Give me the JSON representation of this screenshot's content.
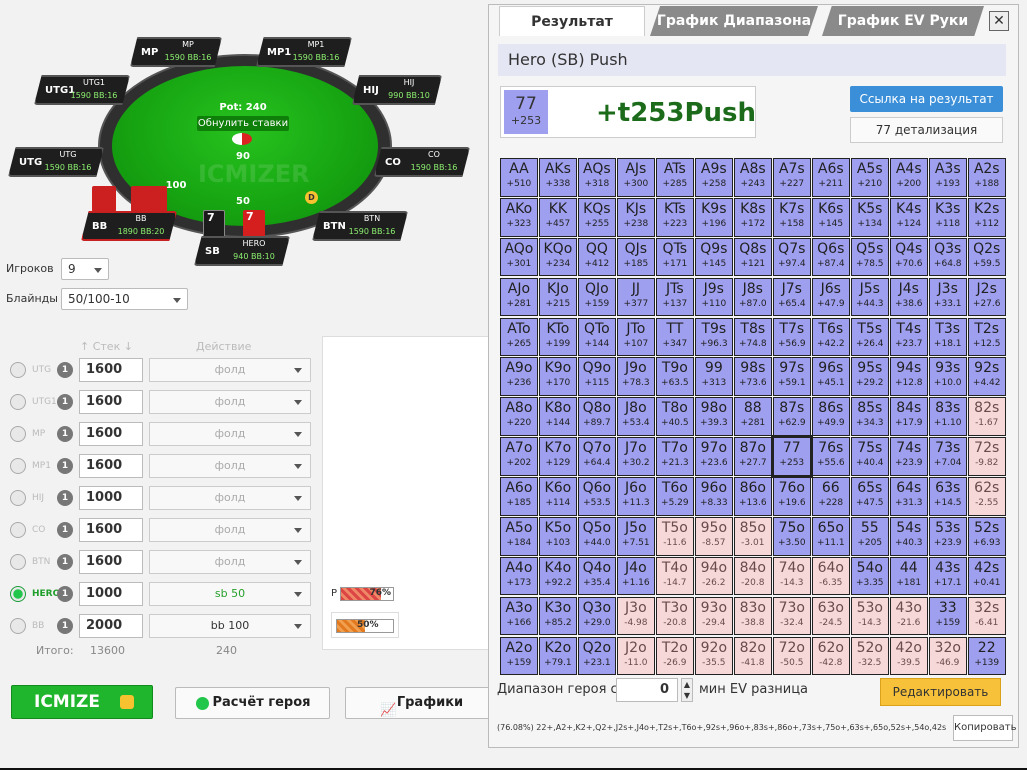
{
  "table": {
    "seats": [
      {
        "pos": "MP",
        "name": "MP",
        "stack": "1590",
        "bb": "BB:16"
      },
      {
        "pos": "MP1",
        "name": "MP1",
        "stack": "1590",
        "bb": "BB:16"
      },
      {
        "pos": "UTG1",
        "name": "UTG1",
        "stack": "1590",
        "bb": "BB:16"
      },
      {
        "pos": "HIJ",
        "name": "HIJ",
        "stack": "990",
        "bb": "BB:10"
      },
      {
        "pos": "UTG",
        "name": "UTG",
        "stack": "1590",
        "bb": "BB:16"
      },
      {
        "pos": "CO",
        "name": "CO",
        "stack": "1590",
        "bb": "BB:16"
      },
      {
        "pos": "BB",
        "name": "BB",
        "stack": "1890",
        "bb": "BB:20"
      },
      {
        "pos": "BTN",
        "name": "BTN",
        "stack": "1590",
        "bb": "BB:16"
      },
      {
        "pos": "SB",
        "name": "HERO",
        "stack": "940",
        "bb": "BB:10"
      }
    ],
    "pot": "Pot: 240",
    "reset": "Обнулить ставки",
    "center_bet": "90",
    "bet_left": "100",
    "bet_sb": "50",
    "watermark": "ICMIZER",
    "hero_cards": [
      "7",
      "7"
    ],
    "dealer": "D"
  },
  "settings": {
    "players_label": "Игроков",
    "players_value": "9",
    "blinds_label": "Блайнды",
    "blinds_value": "50/100-10"
  },
  "players_table": {
    "stack_header": "Стек",
    "action_header": "Действие",
    "rows": [
      {
        "pos": "UTG",
        "n": "1",
        "stack": "1600",
        "action": "фолд"
      },
      {
        "pos": "UTG1",
        "n": "1",
        "stack": "1600",
        "action": "фолд"
      },
      {
        "pos": "MP",
        "n": "1",
        "stack": "1600",
        "action": "фолд"
      },
      {
        "pos": "MP1",
        "n": "1",
        "stack": "1600",
        "action": "фолд"
      },
      {
        "pos": "HIJ",
        "n": "1",
        "stack": "1000",
        "action": "фолд"
      },
      {
        "pos": "CO",
        "n": "1",
        "stack": "1600",
        "action": "фолд"
      },
      {
        "pos": "BTN",
        "n": "1",
        "stack": "1600",
        "action": "фолд"
      },
      {
        "pos": "HERO",
        "n": "1",
        "stack": "1000",
        "action": "sb 50"
      },
      {
        "pos": "BB",
        "n": "1",
        "stack": "2000",
        "action": "bb 100"
      }
    ],
    "total_label": "Итого:",
    "total_stack": "13600",
    "total_action": "240"
  },
  "range_bars": {
    "p_label": "P",
    "p_value": "76%",
    "p_fraction": 0.76,
    "h_value": "50%",
    "h_fraction": 0.5
  },
  "bottom": {
    "icmize": "ICMIZE",
    "hero_calc": "Расчёт героя",
    "charts": "Графики"
  },
  "panel": {
    "tabs": [
      "Результат",
      "График Диапазона",
      "График EV Руки"
    ],
    "header": "Hero (SB) Push",
    "hand": "77",
    "hand_ev": "+253",
    "result": "+t253Push",
    "link_btn": "Ссылка на результат",
    "detail_btn": "77 детализация",
    "range_label": "Диапазон героя с",
    "range_value": "0",
    "range_suffix": "мин EV разница",
    "edit_btn": "Редактировать",
    "range_text": "(76.08%) 22+,A2+,K2+,Q2+,J2s+,J4o+,T2s+,T6o+,92s+,96o+,83s+,86o+,73s+,75o+,63s+,65o,52s+,54o,42s+",
    "copy_btn": "Копировать"
  },
  "matrix": [
    [
      [
        "AA",
        "+510"
      ],
      [
        "AKs",
        "+338"
      ],
      [
        "AQs",
        "+318"
      ],
      [
        "AJs",
        "+300"
      ],
      [
        "ATs",
        "+285"
      ],
      [
        "A9s",
        "+258"
      ],
      [
        "A8s",
        "+243"
      ],
      [
        "A7s",
        "+227"
      ],
      [
        "A6s",
        "+211"
      ],
      [
        "A5s",
        "+210"
      ],
      [
        "A4s",
        "+200"
      ],
      [
        "A3s",
        "+193"
      ],
      [
        "A2s",
        "+188"
      ]
    ],
    [
      [
        "AKo",
        "+323"
      ],
      [
        "KK",
        "+457"
      ],
      [
        "KQs",
        "+255"
      ],
      [
        "KJs",
        "+238"
      ],
      [
        "KTs",
        "+223"
      ],
      [
        "K9s",
        "+196"
      ],
      [
        "K8s",
        "+172"
      ],
      [
        "K7s",
        "+158"
      ],
      [
        "K6s",
        "+145"
      ],
      [
        "K5s",
        "+134"
      ],
      [
        "K4s",
        "+124"
      ],
      [
        "K3s",
        "+118"
      ],
      [
        "K2s",
        "+112"
      ]
    ],
    [
      [
        "AQo",
        "+301"
      ],
      [
        "KQo",
        "+234"
      ],
      [
        "QQ",
        "+412"
      ],
      [
        "QJs",
        "+185"
      ],
      [
        "QTs",
        "+171"
      ],
      [
        "Q9s",
        "+145"
      ],
      [
        "Q8s",
        "+121"
      ],
      [
        "Q7s",
        "+97.4"
      ],
      [
        "Q6s",
        "+87.4"
      ],
      [
        "Q5s",
        "+78.5"
      ],
      [
        "Q4s",
        "+70.6"
      ],
      [
        "Q3s",
        "+64.8"
      ],
      [
        "Q2s",
        "+59.5"
      ]
    ],
    [
      [
        "AJo",
        "+281"
      ],
      [
        "KJo",
        "+215"
      ],
      [
        "QJo",
        "+159"
      ],
      [
        "JJ",
        "+377"
      ],
      [
        "JTs",
        "+137"
      ],
      [
        "J9s",
        "+110"
      ],
      [
        "J8s",
        "+87.0"
      ],
      [
        "J7s",
        "+65.4"
      ],
      [
        "J6s",
        "+47.9"
      ],
      [
        "J5s",
        "+44.3"
      ],
      [
        "J4s",
        "+38.6"
      ],
      [
        "J3s",
        "+33.1"
      ],
      [
        "J2s",
        "+27.6"
      ]
    ],
    [
      [
        "ATo",
        "+265"
      ],
      [
        "KTo",
        "+199"
      ],
      [
        "QTo",
        "+144"
      ],
      [
        "JTo",
        "+107"
      ],
      [
        "TT",
        "+347"
      ],
      [
        "T9s",
        "+96.3"
      ],
      [
        "T8s",
        "+74.8"
      ],
      [
        "T7s",
        "+56.9"
      ],
      [
        "T6s",
        "+42.2"
      ],
      [
        "T5s",
        "+26.4"
      ],
      [
        "T4s",
        "+23.7"
      ],
      [
        "T3s",
        "+18.1"
      ],
      [
        "T2s",
        "+12.5"
      ]
    ],
    [
      [
        "A9o",
        "+236"
      ],
      [
        "K9o",
        "+170"
      ],
      [
        "Q9o",
        "+115"
      ],
      [
        "J9o",
        "+78.3"
      ],
      [
        "T9o",
        "+63.5"
      ],
      [
        "99",
        "+313"
      ],
      [
        "98s",
        "+73.6"
      ],
      [
        "97s",
        "+59.1"
      ],
      [
        "96s",
        "+45.1"
      ],
      [
        "95s",
        "+29.2"
      ],
      [
        "94s",
        "+12.8"
      ],
      [
        "93s",
        "+10.0"
      ],
      [
        "92s",
        "+4.42"
      ]
    ],
    [
      [
        "A8o",
        "+220"
      ],
      [
        "K8o",
        "+144"
      ],
      [
        "Q8o",
        "+89.7"
      ],
      [
        "J8o",
        "+53.4"
      ],
      [
        "T8o",
        "+40.5"
      ],
      [
        "98o",
        "+39.3"
      ],
      [
        "88",
        "+281"
      ],
      [
        "87s",
        "+62.9"
      ],
      [
        "86s",
        "+49.9"
      ],
      [
        "85s",
        "+34.3"
      ],
      [
        "84s",
        "+17.9"
      ],
      [
        "83s",
        "+1.10"
      ],
      [
        "82s",
        "-1.67"
      ]
    ],
    [
      [
        "A7o",
        "+202"
      ],
      [
        "K7o",
        "+129"
      ],
      [
        "Q7o",
        "+64.4"
      ],
      [
        "J7o",
        "+30.2"
      ],
      [
        "T7o",
        "+21.3"
      ],
      [
        "97o",
        "+23.6"
      ],
      [
        "87o",
        "+27.7"
      ],
      [
        "77",
        "+253"
      ],
      [
        "76s",
        "+55.6"
      ],
      [
        "75s",
        "+40.4"
      ],
      [
        "74s",
        "+23.9"
      ],
      [
        "73s",
        "+7.04"
      ],
      [
        "72s",
        "-9.82"
      ]
    ],
    [
      [
        "A6o",
        "+185"
      ],
      [
        "K6o",
        "+114"
      ],
      [
        "Q6o",
        "+53.5"
      ],
      [
        "J6o",
        "+11.3"
      ],
      [
        "T6o",
        "+5.29"
      ],
      [
        "96o",
        "+8.33"
      ],
      [
        "86o",
        "+13.6"
      ],
      [
        "76o",
        "+19.6"
      ],
      [
        "66",
        "+228"
      ],
      [
        "65s",
        "+47.5"
      ],
      [
        "64s",
        "+31.3"
      ],
      [
        "63s",
        "+14.5"
      ],
      [
        "62s",
        "-2.55"
      ]
    ],
    [
      [
        "A5o",
        "+184"
      ],
      [
        "K5o",
        "+103"
      ],
      [
        "Q5o",
        "+44.0"
      ],
      [
        "J5o",
        "+7.51"
      ],
      [
        "T5o",
        "-11.6"
      ],
      [
        "95o",
        "-8.57"
      ],
      [
        "85o",
        "-3.01"
      ],
      [
        "75o",
        "+3.50"
      ],
      [
        "65o",
        "+11.1"
      ],
      [
        "55",
        "+205"
      ],
      [
        "54s",
        "+40.3"
      ],
      [
        "53s",
        "+23.9"
      ],
      [
        "52s",
        "+6.93"
      ]
    ],
    [
      [
        "A4o",
        "+173"
      ],
      [
        "K4o",
        "+92.2"
      ],
      [
        "Q4o",
        "+35.4"
      ],
      [
        "J4o",
        "+1.16"
      ],
      [
        "T4o",
        "-14.7"
      ],
      [
        "94o",
        "-26.2"
      ],
      [
        "84o",
        "-20.8"
      ],
      [
        "74o",
        "-14.3"
      ],
      [
        "64o",
        "-6.35"
      ],
      [
        "54o",
        "+3.35"
      ],
      [
        "44",
        "+181"
      ],
      [
        "43s",
        "+17.1"
      ],
      [
        "42s",
        "+0.41"
      ]
    ],
    [
      [
        "A3o",
        "+166"
      ],
      [
        "K3o",
        "+85.2"
      ],
      [
        "Q3o",
        "+29.0"
      ],
      [
        "J3o",
        "-4.98"
      ],
      [
        "T3o",
        "-20.8"
      ],
      [
        "93o",
        "-29.4"
      ],
      [
        "83o",
        "-38.8"
      ],
      [
        "73o",
        "-32.4"
      ],
      [
        "63o",
        "-24.5"
      ],
      [
        "53o",
        "-14.3"
      ],
      [
        "43o",
        "-21.6"
      ],
      [
        "33",
        "+159"
      ],
      [
        "32s",
        "-6.41"
      ]
    ],
    [
      [
        "A2o",
        "+159"
      ],
      [
        "K2o",
        "+79.1"
      ],
      [
        "Q2o",
        "+23.1"
      ],
      [
        "J2o",
        "-11.0"
      ],
      [
        "T2o",
        "-26.9"
      ],
      [
        "92o",
        "-35.5"
      ],
      [
        "82o",
        "-41.8"
      ],
      [
        "72o",
        "-50.5"
      ],
      [
        "62o",
        "-42.8"
      ],
      [
        "52o",
        "-32.5"
      ],
      [
        "42o",
        "-39.5"
      ],
      [
        "32o",
        "-46.9"
      ],
      [
        "22",
        "+139"
      ]
    ]
  ],
  "colors": {
    "push": "#9f9ff0",
    "fold": "#f7d8d8",
    "accent_green": "#1fb52c",
    "blue_btn": "#3a8fd8",
    "yellow_btn": "#f7c23a"
  }
}
